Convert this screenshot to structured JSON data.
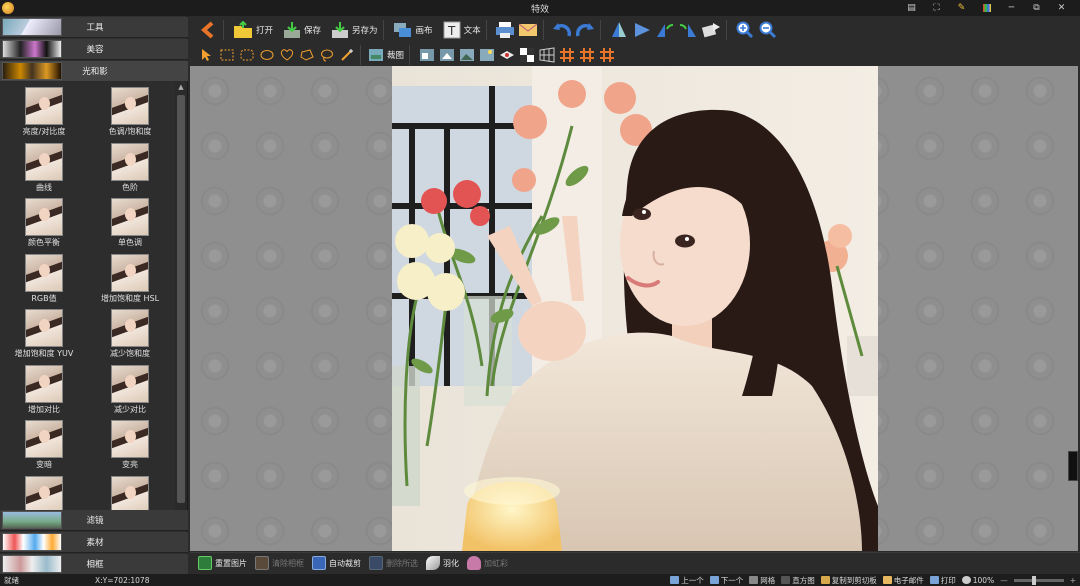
{
  "window": {
    "title": "特效"
  },
  "window_controls": [
    "file-icon",
    "fullscreen-icon",
    "pencil-icon",
    "palette-icon",
    "minimize-icon",
    "restore-icon",
    "close-icon"
  ],
  "sidebar": {
    "categories_top": [
      {
        "label": "工具",
        "active": false
      },
      {
        "label": "美容",
        "active": false
      },
      {
        "label": "光和影",
        "active": true
      }
    ],
    "filters": [
      {
        "label": "亮度/对比度"
      },
      {
        "label": "色调/饱和度"
      },
      {
        "label": "曲线"
      },
      {
        "label": "色阶"
      },
      {
        "label": "颜色平衡"
      },
      {
        "label": "单色调"
      },
      {
        "label": "RGB值"
      },
      {
        "label": "增加饱和度 HSL"
      },
      {
        "label": "增加饱和度 YUV"
      },
      {
        "label": "减少饱和度"
      },
      {
        "label": "增加对比"
      },
      {
        "label": "减少对比"
      },
      {
        "label": "变暗"
      },
      {
        "label": "变亮"
      },
      {
        "label": ""
      },
      {
        "label": ""
      }
    ],
    "categories_bottom": [
      {
        "label": "滤镜"
      },
      {
        "label": "素材"
      },
      {
        "label": "相框"
      }
    ]
  },
  "toolbar_main": {
    "back_icon": "back-arrow-icon",
    "open": "打开",
    "save": "保存",
    "save_as": "另存为",
    "canvas": "画布",
    "text": "文本"
  },
  "toolbar_select": {
    "crop_label": "裁图"
  },
  "actions": {
    "reset": "重置图片",
    "clear_frame": "清除相框",
    "auto_crop": "自动裁剪",
    "delete_selection": "删除所选",
    "feather": "羽化",
    "heart_frame": "加虹彩"
  },
  "status": {
    "state": "就绪",
    "coords": "X:Y=702:1078",
    "prev": "上一个",
    "next": "下一个",
    "grid": "网格",
    "histogram": "直方图",
    "copy_clip": "复制到剪切板",
    "email": "电子邮件",
    "print": "打印",
    "zoom": "100%"
  },
  "colors": {
    "accent_orange": "#e8742a",
    "blue_icon": "#3b7bd6",
    "bg_dark": "#2b2b2b"
  }
}
